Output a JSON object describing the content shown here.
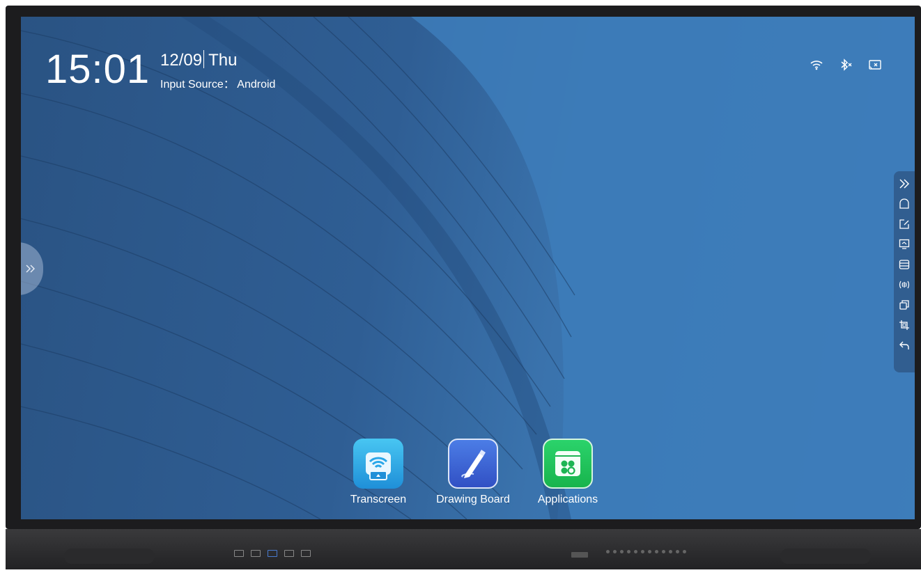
{
  "clock": {
    "time": "15:01",
    "date": "12/09",
    "day": "Thu"
  },
  "input_source": "Input Source： Android",
  "status_icons": [
    "wifi-icon",
    "bluetooth-off-icon",
    "screen-share-icon"
  ],
  "side_toolbar": [
    "expand-double-chevron-icon",
    "home-icon",
    "annotate-icon",
    "screen-icon",
    "storage-icon",
    "signal-icon",
    "window-icon",
    "screenshot-icon",
    "back-icon"
  ],
  "apps": [
    {
      "label": "Transcreen"
    },
    {
      "label": "Drawing Board"
    },
    {
      "label": "Applications"
    }
  ],
  "colors": {
    "wallpaper": "#2f5e94",
    "bezel": "#1c1c1e",
    "accent_green": "#22c55e"
  }
}
